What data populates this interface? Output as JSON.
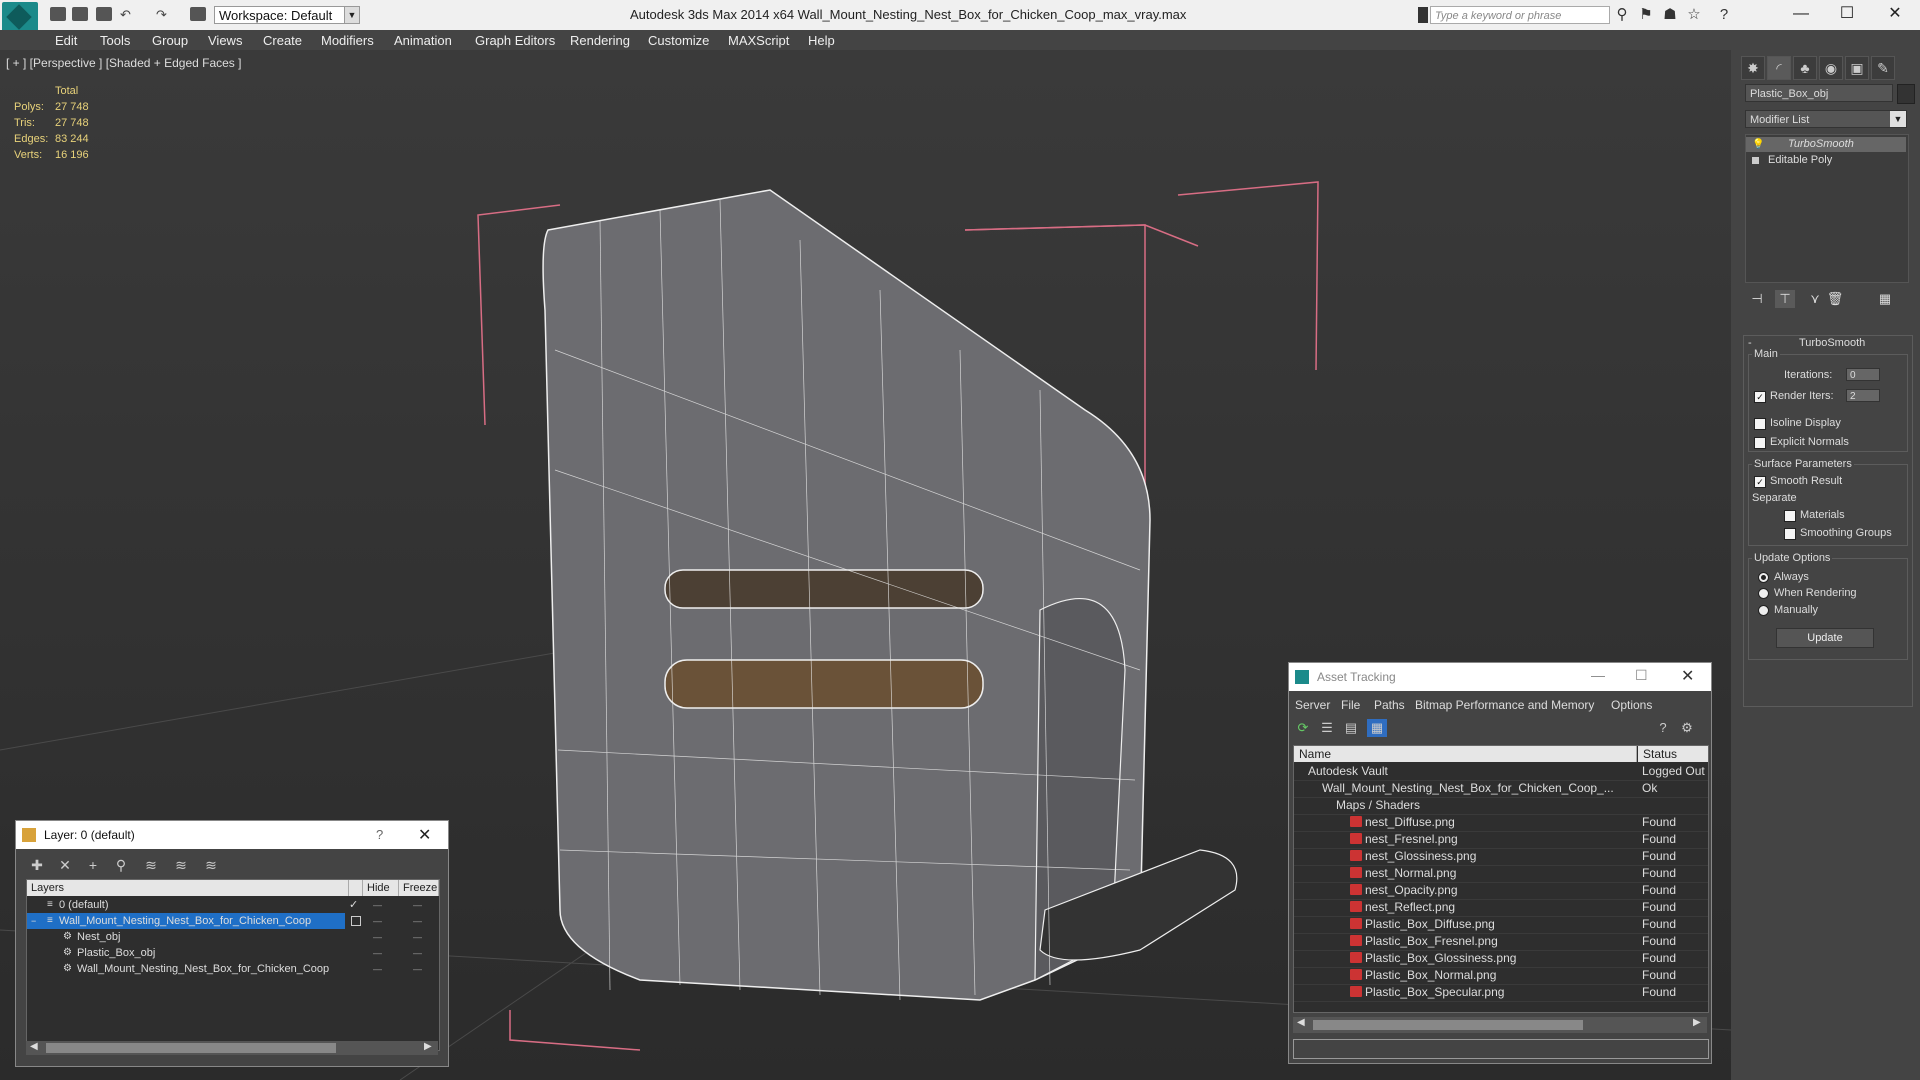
{
  "titlebar": {
    "workspace": "Workspace: Default",
    "app_title": "Autodesk 3ds Max  2014 x64       Wall_Mount_Nesting_Nest_Box_for_Chicken_Coop_max_vray.max",
    "search_placeholder": "Type a keyword or phrase"
  },
  "menu": [
    "Edit",
    "Tools",
    "Group",
    "Views",
    "Create",
    "Modifiers",
    "Animation",
    "Graph Editors",
    "Rendering",
    "Customize",
    "MAXScript",
    "Help"
  ],
  "viewport": {
    "label": "[ + ] [Perspective ] [Shaded + Edged Faces ]",
    "stats": {
      "header": "Total",
      "rows": [
        {
          "label": "Polys:",
          "value": "27 748"
        },
        {
          "label": "Tris:",
          "value": "27 748"
        },
        {
          "label": "Edges:",
          "value": "83 244"
        },
        {
          "label": "Verts:",
          "value": "16 196"
        }
      ]
    }
  },
  "command_panel": {
    "object_name": "Plastic_Box_obj",
    "modifier_list": "Modifier List",
    "stack": [
      "TurboSmooth",
      "Editable Poly"
    ],
    "turbosmooth": {
      "title": "TurboSmooth",
      "main": "Main",
      "iterations_label": "Iterations:",
      "iterations_value": "0",
      "render_iters_label": "Render Iters:",
      "render_iters_value": "2",
      "isoline": "Isoline Display",
      "explicit_normals": "Explicit Normals",
      "surface_params": "Surface Parameters",
      "smooth_result": "Smooth Result",
      "separate": "Separate",
      "materials": "Materials",
      "smoothing_groups": "Smoothing Groups",
      "update_options": "Update Options",
      "always": "Always",
      "when_rendering": "When Rendering",
      "manually": "Manually",
      "update_button": "Update"
    }
  },
  "layer_window": {
    "title": "Layer: 0 (default)",
    "help": "?",
    "columns": [
      "Layers",
      "Hide",
      "Freeze"
    ],
    "rows": [
      {
        "name": "0 (default)",
        "indent": 1,
        "selected": false
      },
      {
        "name": "Wall_Mount_Nesting_Nest_Box_for_Chicken_Coop",
        "indent": 1,
        "selected": true
      },
      {
        "name": "Nest_obj",
        "indent": 2,
        "selected": false
      },
      {
        "name": "Plastic_Box_obj",
        "indent": 2,
        "selected": false
      },
      {
        "name": "Wall_Mount_Nesting_Nest_Box_for_Chicken_Coop",
        "indent": 2,
        "selected": false
      }
    ]
  },
  "asset_tracking": {
    "title": "Asset Tracking",
    "menu": [
      "Server",
      "File",
      "Paths",
      "Bitmap Performance and Memory",
      "Options"
    ],
    "columns": [
      "Name",
      "Status"
    ],
    "rows": [
      {
        "name": "Autodesk Vault",
        "status": "Logged Out",
        "indent": 0
      },
      {
        "name": "Wall_Mount_Nesting_Nest_Box_for_Chicken_Coop_...",
        "status": "Ok",
        "indent": 1
      },
      {
        "name": "Maps / Shaders",
        "status": "",
        "indent": 2
      },
      {
        "name": "nest_Diffuse.png",
        "status": "Found",
        "indent": 3
      },
      {
        "name": "nest_Fresnel.png",
        "status": "Found",
        "indent": 3
      },
      {
        "name": "nest_Glossiness.png",
        "status": "Found",
        "indent": 3
      },
      {
        "name": "nest_Normal.png",
        "status": "Found",
        "indent": 3
      },
      {
        "name": "nest_Opacity.png",
        "status": "Found",
        "indent": 3
      },
      {
        "name": "nest_Reflect.png",
        "status": "Found",
        "indent": 3
      },
      {
        "name": "Plastic_Box_Diffuse.png",
        "status": "Found",
        "indent": 3
      },
      {
        "name": "Plastic_Box_Fresnel.png",
        "status": "Found",
        "indent": 3
      },
      {
        "name": "Plastic_Box_Glossiness.png",
        "status": "Found",
        "indent": 3
      },
      {
        "name": "Plastic_Box_Normal.png",
        "status": "Found",
        "indent": 3
      },
      {
        "name": "Plastic_Box_Specular.png",
        "status": "Found",
        "indent": 3
      }
    ]
  }
}
